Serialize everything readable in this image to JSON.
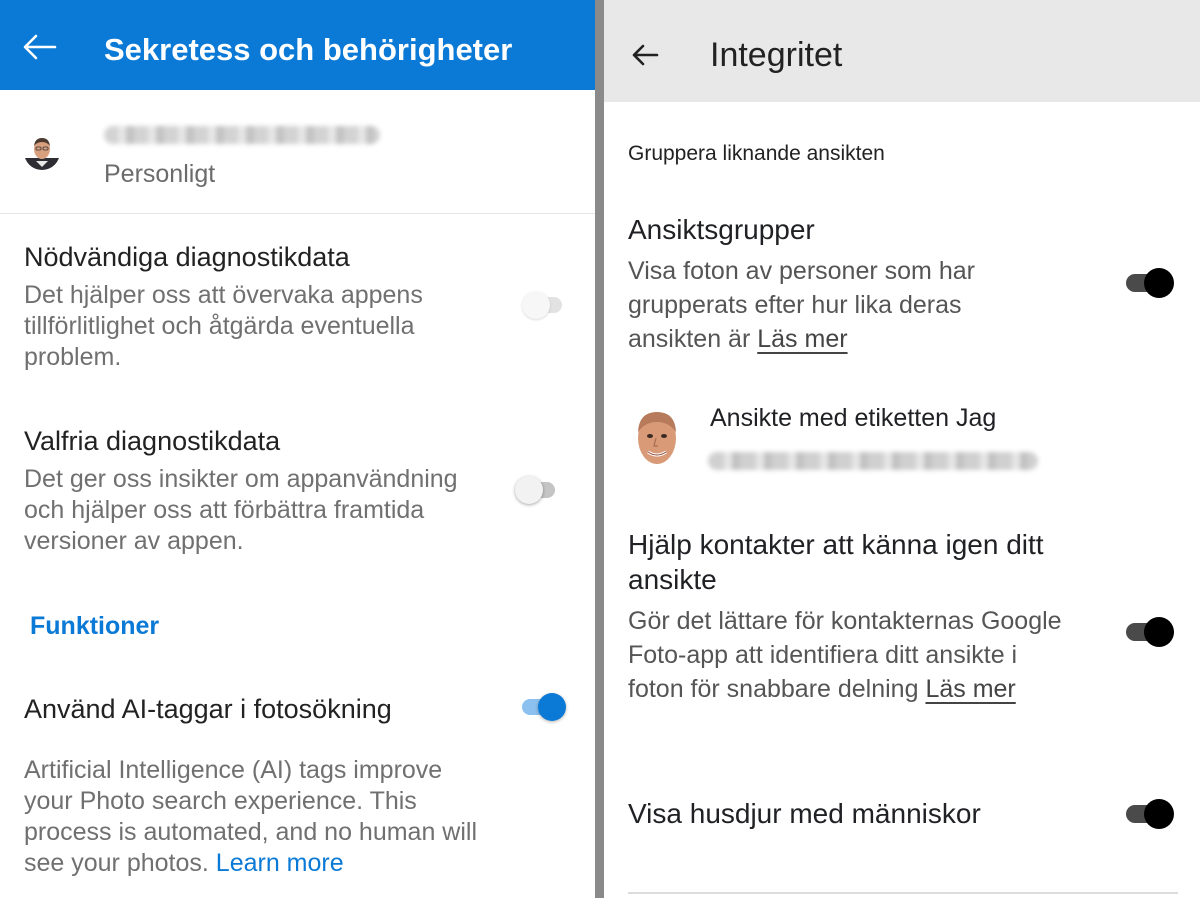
{
  "left": {
    "header": {
      "title": "Sekretess och behörigheter",
      "back_icon": "arrow-left-icon",
      "background": "#0a7ad6"
    },
    "account": {
      "type_label": "Personligt",
      "email_visible": false
    },
    "settings": [
      {
        "title": "Nödvändiga diagnostikdata",
        "description": "Det hjälper oss att övervaka appens tillförlitlighet och åtgärda eventuella problem.",
        "toggle": "off-disabled"
      },
      {
        "title": "Valfria diagnostikdata",
        "description": "Det ger oss insikter om appanvändning och hjälper oss att förbättra framtida versioner av appen.",
        "toggle": "off"
      }
    ],
    "section_label": "Funktioner",
    "ai_tags": {
      "title": "Använd AI-taggar i fotosökning",
      "description": "Artificial Intelligence (AI) tags improve your Photo search experience. This process is automated, and no human will see your photos.",
      "link": "Learn more",
      "toggle": "on"
    }
  },
  "right": {
    "header": {
      "title": "Integritet",
      "back_icon": "arrow-left-icon",
      "background": "#e8e8e8"
    },
    "section_label": "Gruppera liknande ansikten",
    "face_groups": {
      "title": "Ansiktsgrupper",
      "description": "Visa foton av personer som har grupperats efter hur lika deras ansikten är",
      "link": "Läs mer",
      "toggle": "on"
    },
    "labeled_face": {
      "title": "Ansikte med etiketten Jag",
      "email_visible": false
    },
    "contacts_recognize": {
      "title": "Hjälp kontakter att känna igen ditt ansikte",
      "description": "Gör det lättare för kontakternas Google Foto-app att identifiera ditt ansikte i foton för snabbare delning",
      "link": "Läs mer",
      "toggle": "on"
    },
    "pets": {
      "title": "Visa husdjur med människor",
      "toggle": "on"
    }
  }
}
